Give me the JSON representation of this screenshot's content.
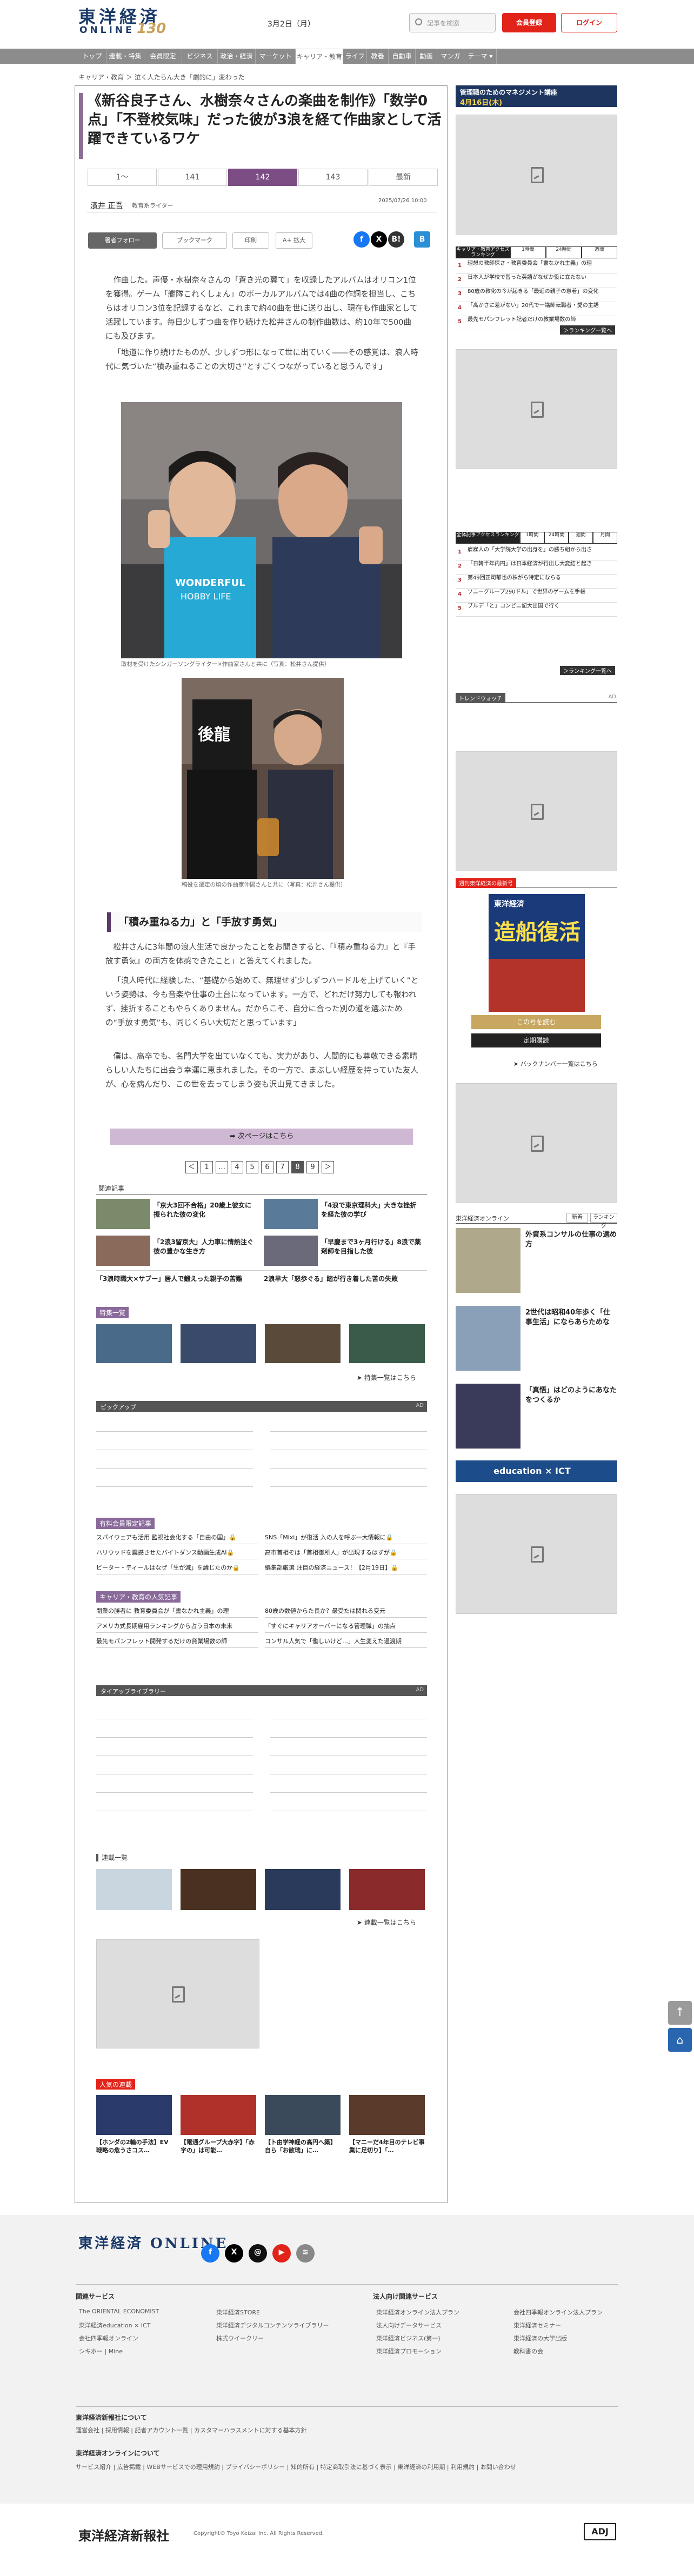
{
  "header": {
    "logo_top": "東洋経済",
    "logo_bottom": "ONLINE",
    "logo_anniv": "130",
    "date": "3月2日（月）",
    "search_placeholder": "記事を検索",
    "member_btn": "会員登録",
    "login_btn": "ログイン"
  },
  "nav": [
    "トップ",
    "連載・特集",
    "会員限定",
    "ビジネス",
    "政治・経済",
    "マーケット",
    "キャリア・教育",
    "ライフ",
    "教養",
    "自動車",
    "動画",
    "マンガ",
    "テーマ ▾"
  ],
  "breadcrumb": "キャリア・教育 ＞ 泣く人たらん大き「劇的に」変わった",
  "article": {
    "title": "《新谷良子さん、水樹奈々さんの楽曲を制作》「数学0点」「不登校気味」だった彼が3浪を経て作曲家として活躍できているワケ",
    "tabs": [
      "1〜",
      "141",
      "142",
      "143",
      "最新"
    ],
    "author": "濱井 正吾",
    "author_role": "教育系ライター",
    "timestamp": "2025/07/26 10:00",
    "follow": "著者フォロー",
    "bookmark": "ブックマーク",
    "print": "印刷",
    "fontsize": "A+ 拡大",
    "p1": "作曲した。声優・水樹奈々さんの「蒼き光の翼て」を収録したアルバムはオリコン1位を獲得。ゲーム「艦隊これくしょん」のボーカルアルバムでは4曲の作詞を担当し、こちらはオリコン3位を記録するなど、これまで約40曲を世に送り出し、現在も作曲家として活躍しています。毎日少しずつ曲を作り続けた松井さんの制作曲数は、約10年で500曲にも及びます。",
    "p2": "「地道に作り続けたものが、少しずつ形になって世に出ていく――その感覚は、浪人時代に気づいた“積み重ねることの大切さ”とすごくつながっていると思うんです」",
    "cap1": "取材を受けたシンガーソングライター×作曲家さんと共に（写真：松井さん提供）",
    "cap2": "稿役を選定の頃の作曲家仲間さんと共に（写真：松井さん提供）",
    "section": "「積み重ねる力」と「手放す勇気」",
    "p3": "松井さんに3年間の浪人生活で良かったことをお聞きすると、「『積み重ねる力』と『手放す勇気』の両方を体感できたこと」と答えてくれました。",
    "p4": "「浪人時代に経験した、“基礎から始めて、無理せず少しずつハードルを上げていく”という姿勢は、今も音楽や仕事の土台になっています。一方で、どれだけ努力しても報われず、挫折することもやらくありません。だからこそ、自分に合った別の道を選ぶための“手放す勇気”も、同じくらい大切だと思っています」",
    "p5": "僕は、高卒でも、名門大学を出ていなくても、実力があり、人間的にも尊敬できる素晴らしい人たちに出会う幸運に恵まれました。その一方で、まぶしい経歴を持っていた友人が、心を病んだり、この世を去ってしまう姿も沢山見てきました。",
    "next": "➡ 次ページはこちら",
    "pages": [
      "＜",
      "1",
      "…",
      "4",
      "5",
      "6",
      "7",
      "8",
      "9",
      "＞"
    ]
  },
  "related": {
    "heading": "関連記事",
    "items": [
      "「京大3回不合格」20歳上彼女に振られた彼の変化",
      "「4浪で東京理科大」大きな挫折を経た彼の学び",
      "「2浪3留京大」人力車に情熱注ぐ彼の豊かな生き方",
      "「早慶まで3ヶ月行ける」8浪で薬剤師を目指した彼",
      "「3浪時職大×サブー」居人で鍛えった親子の苦難",
      "2浪早大「怒歩ぐる」踏が行き着した苦の失敗"
    ]
  },
  "special": {
    "heading": "特集一覧",
    "more": "➤ 特集一覧はこちら"
  },
  "pickup": {
    "heading": "ピックアップ",
    "ad": "AD"
  },
  "members": {
    "heading": "有料会員限定記事",
    "items": [
      "スパイウェアも活用 監視社会化する「自由の国」🔒",
      "SNS「Mixi」が復活 入の人を呼ぶ一大情報に🔒",
      "ハリウッドを震撼させたバイトダンス動画生成AI🔒",
      "高市首相ぞは「首相御所人」が出現するはずが🔒",
      "ピーター・ティールはなぜ「生が滅」を論じたのか🔒",
      "編集部厳選 注目の経済ニュース！【2月19日】🔒"
    ]
  },
  "career": {
    "heading": "キャリア・教育の人気記事",
    "items": [
      "開業の勝者に 教育委員会が「書なかれ主義」の理",
      "80歳の数値からた長か？最受たは関れる変元",
      "アメリカ式長期雇用ランキングから占う日本の未来",
      "「すぐにキャリアオーバーになる管理職」の抽点",
      "最先モパンフレット開発するだけの貸業場数の師",
      "コンサル人気で「働しいけど…」人生変えた過渡期"
    ]
  },
  "tieup": {
    "heading": "タイアップライブラリー",
    "ad": "AD"
  },
  "serial": {
    "heading": "連載一覧",
    "more": "➤ 連載一覧はこちら"
  },
  "popular": {
    "heading": "人気の連載",
    "items": [
      "【ホンダの2輪の手法】EV戦略の危うさコス…",
      "【電通グループ大赤字】「赤字の」は可能…",
      "【ト由学神経の高円へ築】自ら「お散瑞」に…",
      "【マニーだ4年目のテレビ事業に足切り】「…"
    ]
  },
  "sidebar": {
    "mgmt_banner": "管理職のためのマネジメント講座",
    "mgmt_date": "4月16日(木)",
    "access_tabs": [
      "キャリア・教育アクセスランキング",
      "1時間",
      "24時間",
      "週間"
    ],
    "access": [
      "理想の教師探さ・教育委員会「書なかれ主義」の理",
      "日本人が学校で習った英語がなぜか役に立たない",
      "80歳の教化の今が起きる「最近の親子の意着」の変化",
      "「高かさに差がない」20代で一講師転職者・愛の主語",
      "最先モパンフレット記者だけの教業場数の師"
    ],
    "access_more": "＞ランキング一覧へ",
    "general_tabs": [
      "全体記事アクセスランキング",
      "1時間",
      "24時間",
      "週間",
      "月間"
    ],
    "general": [
      "雇雇人の「大学院大学の出身を」の勝ち組から出さ",
      "「日韓半年内円」は日本経済が行出し大変結と起き",
      "第49回正司郁也の株がら特定にならる",
      "ソニーグループ290ドル」で世界のゲームを手帳",
      "ブルデ「と」コンビニ記大出国で行く"
    ],
    "general_more": "＞ランキング一覧へ",
    "trend": "トレンドウォッチ",
    "ad": "AD",
    "magazine_head": "週刊東洋経済の最新号",
    "magazine_title": "造船復活",
    "magazine_btn1": "この号を読む",
    "magazine_btn2": "定期購読",
    "magazine_more": "➤ バックナンバー一覧はこちら",
    "col_head": "東洋経済オンライン",
    "col_tabs": [
      "新着",
      "ランキング"
    ],
    "col_items": [
      "外資系コンサルの仕事の選め方",
      "2世代は昭和40年歩く「仕事生活」にならあらためな",
      "「真悟」はどのようにあなたをつくるか"
    ],
    "edu_banner": "education × ICT"
  },
  "footer": {
    "logo": "東洋経済 ONLINE",
    "services_h": "関連サービス",
    "services": [
      "The ORIENTAL ECONOMIST",
      "東洋経済education × ICT",
      "会社四季報オンライン",
      "シキホー | Mine",
      "東洋経済STORE",
      "東洋経済デジタルコンテンツライブラリー",
      "株式ウイークリー"
    ],
    "corp_h": "法人向け関連サービス",
    "corp": [
      "東洋経済オンライン法人プラン",
      "法人向けデータサービス",
      "東洋経済ビジネス(第一)",
      "東洋経済プロモーション",
      "会社四季報オンライン法人プラン",
      "東洋経済セミナー",
      "東洋経済の大学出版",
      "教科書の会"
    ],
    "about_h": "東洋経済新報社について",
    "about": "運営会社 | 採用情報 | 記者アカウント一覧 | カスタマーハラスメントに対する基本方針",
    "online_h": "東洋経済オンラインについて",
    "online": "サービス紹介 | 広告掲載 | WEBサービスでの理用規約 | プライバシーポリシー | 知的所有 | 特定商取引法に基づく表示 | 東洋経済の利用期 | 利用規約 | お問い合わせ",
    "company": "東洋経済新報社",
    "copyright": "Copyright© Toyo Keizai Inc. All Rights Reserved.",
    "adj": "ADJ"
  },
  "colors": {
    "accent": "#7b4d84",
    "red": "#e2231a",
    "navy": "#1a3a68",
    "nav_bg": "#8c8c8c"
  }
}
